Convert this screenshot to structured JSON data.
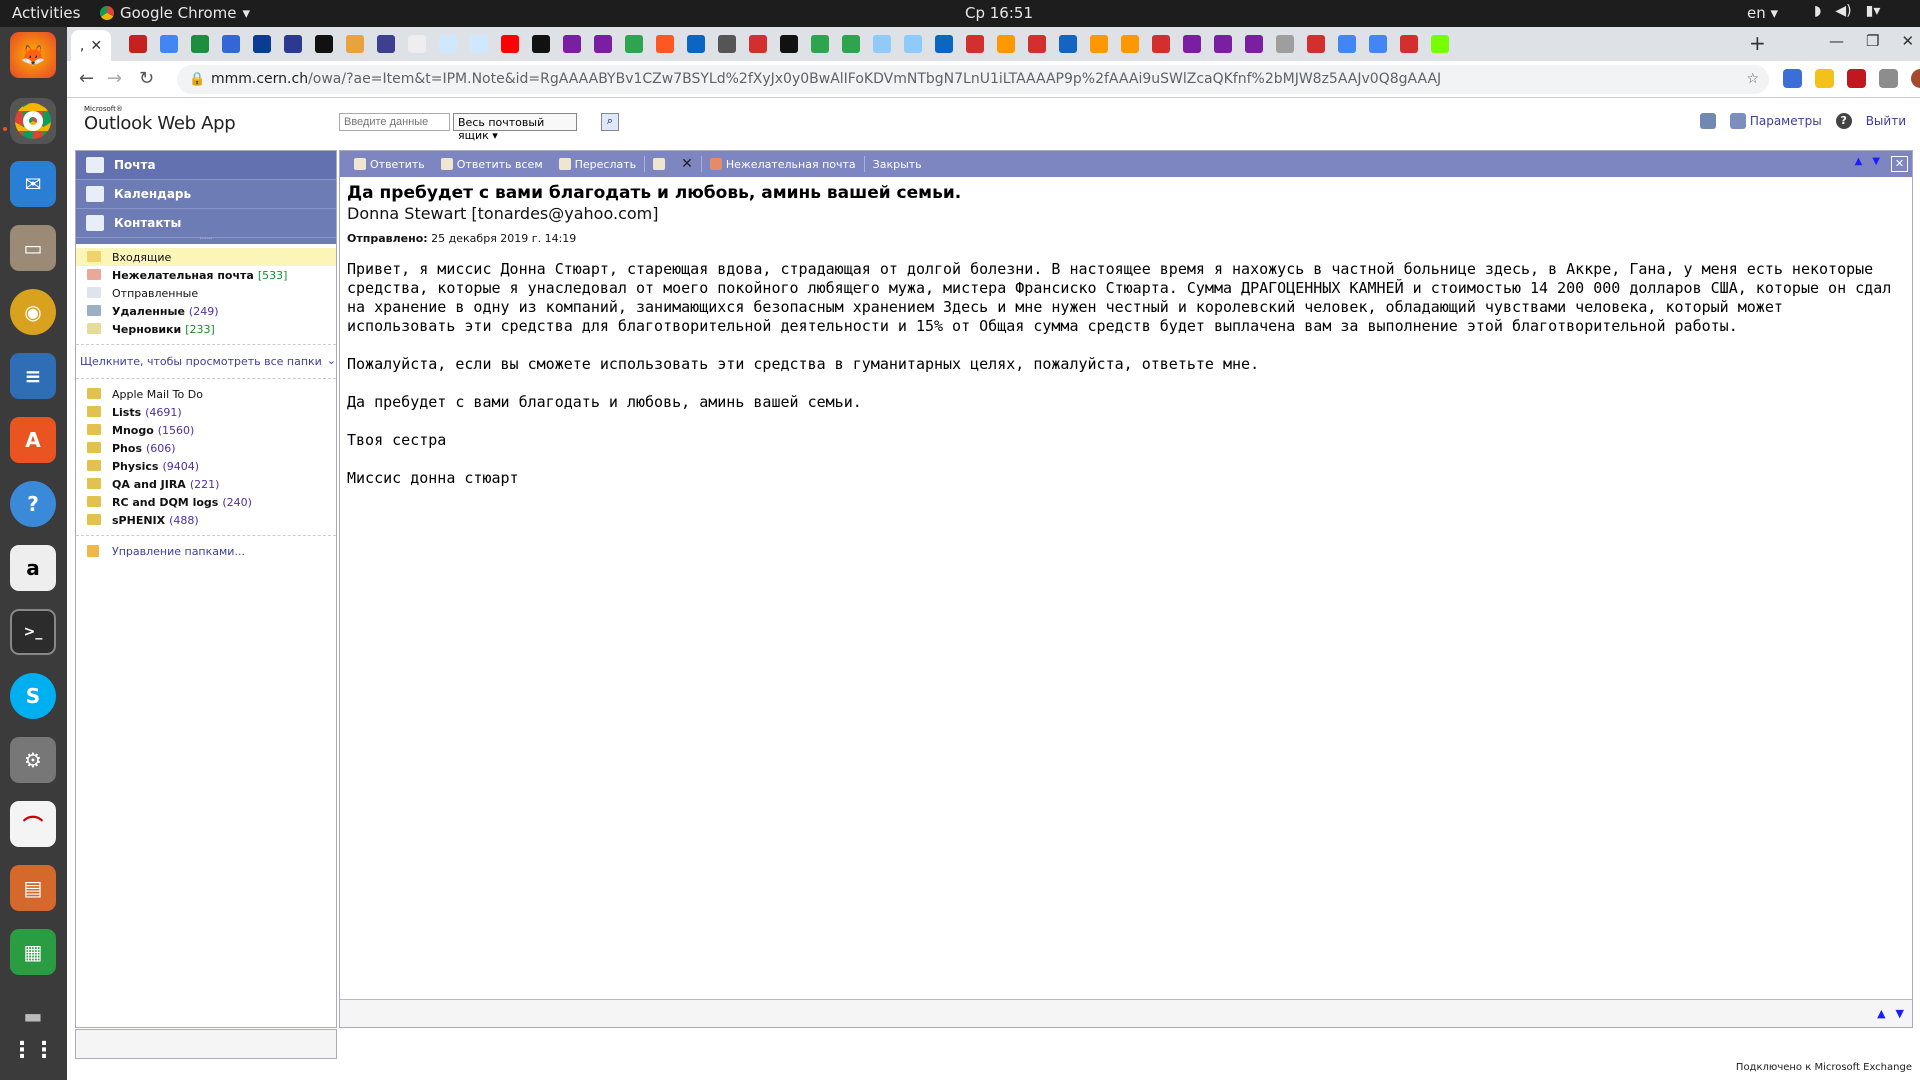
{
  "system": {
    "activities": "Activities",
    "app_name": "Google Chrome",
    "clock": "Ср 16:51",
    "lang": "en"
  },
  "browser": {
    "active_tab_label": ",",
    "url_domain": "mmm.cern.ch",
    "url_path": "/owa/?ae=Item&t=IPM.Note&id=RgAAAABYBv1CZw7BSYLd%2fXyJx0y0BwAlIFoKDVmNTbgN7LnU1iLTAAAAP9p%2fAAAi9uSWlZcaQKfnf%2bMJW8z5AAJv0Q8gAAAJ"
  },
  "owa": {
    "logo_small": "Microsoft®",
    "logo_title": "Outlook Web App",
    "search_placeholder": "Введите данные",
    "search_scope": "Весь почтовый ящик",
    "options_label": "Параметры",
    "help_label": "?",
    "logout_label": "Выйти",
    "nav": {
      "mail": "Почта",
      "calendar": "Календарь",
      "contacts": "Контакты"
    },
    "folders": [
      {
        "name": "Входящие",
        "count": ""
      },
      {
        "name": "Нежелательная почта",
        "count": "[533]"
      },
      {
        "name": "Отправленные",
        "count": ""
      },
      {
        "name": "Удаленные",
        "count": "(249)"
      },
      {
        "name": "Черновики",
        "count": "[233]"
      }
    ],
    "show_all_folders": "Щелкните, чтобы просмотреть все папки",
    "user_folders": [
      {
        "name": "Apple Mail To Do",
        "count": ""
      },
      {
        "name": "Lists",
        "count": "(4691)"
      },
      {
        "name": "Mnogo",
        "count": "(1560)"
      },
      {
        "name": "Phos",
        "count": "(606)"
      },
      {
        "name": "Physics",
        "count": "(9404)"
      },
      {
        "name": "QA and JIRA",
        "count": "(221)"
      },
      {
        "name": "RC and DQM logs",
        "count": "(240)"
      },
      {
        "name": "sPHENIX",
        "count": "(488)"
      }
    ],
    "manage_folders": "Управление папками...",
    "toolbar": {
      "reply": "Ответить",
      "reply_all": "Ответить всем",
      "forward": "Переслать",
      "junk": "Нежелательная почта",
      "close": "Закрыть"
    },
    "message": {
      "subject": "Да пребудет с вами благодать и любовь, аминь вашей семьи.",
      "from": "Donna Stewart [tonardes@yahoo.com]",
      "sent_label": "Отправлено:",
      "sent_value": "25 декабря 2019 г. 14:19",
      "body": "Привет, я миссис Донна Стюарт, стареющая вдова, страдающая от долгой болезни. В настоящее время я нахожусь в частной больнице здесь, в Аккре, Гана, у меня есть некоторые средства, которые я унаследовал от моего покойного любящего мужа, мистера Франсиско Стюарта. Сумма ДРАГОЦЕННЫХ КАМНЕЙ и стоимостью 14 200 000 долларов США, которые он сдал на хранение в одну из компаний, занимающихся безопасным хранением Здесь и мне нужен честный и королевский человек, обладающий чувствами человека, который может использовать эти средства для благотворительной деятельности и 15% от Общая сумма средств будет выплачена вам за выполнение этой благотворительной работы.\n\nПожалуйста, если вы сможете использовать эти средства в гуманитарных целях, пожалуйста, ответьте мне.\n\nДа пребудет с вами благодать и любовь, аминь вашей семьи.\n\nТвоя сестра\n\nМиссис донна стюарт"
    },
    "status": "Подключено к Microsoft Exchange"
  }
}
